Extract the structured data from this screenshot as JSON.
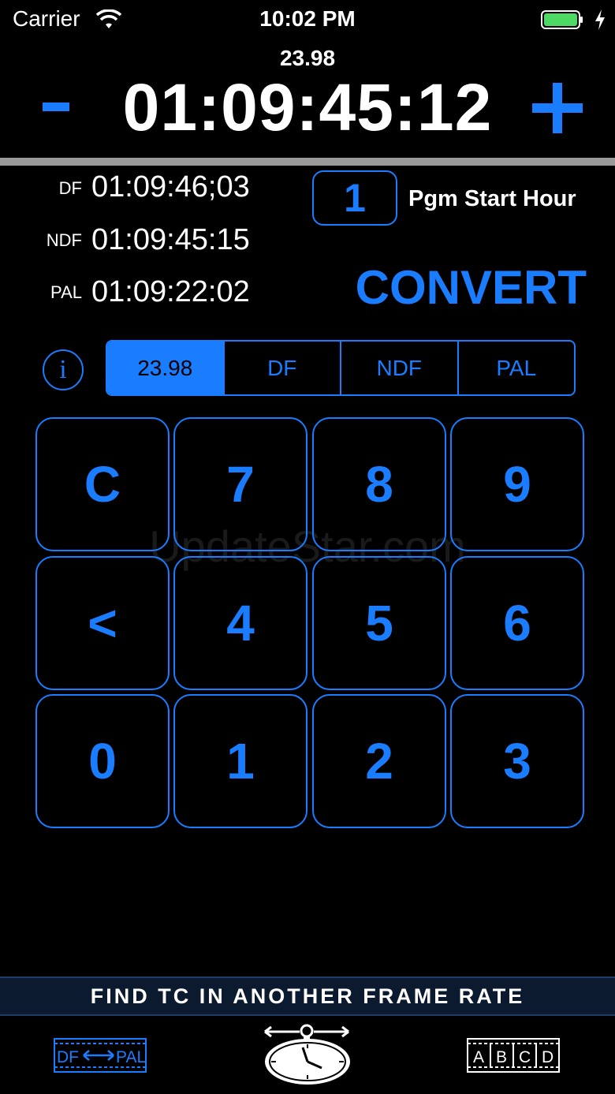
{
  "status_bar": {
    "carrier": "Carrier",
    "time": "10:02 PM"
  },
  "header": {
    "frame_rate": "23.98",
    "timecode": "01:09:45:12",
    "minus_label": "-",
    "plus_label": "+"
  },
  "conversions": [
    {
      "label": "DF",
      "value": "01:09:46;03"
    },
    {
      "label": "NDF",
      "value": "01:09:45:15"
    },
    {
      "label": "PAL",
      "value": "01:09:22:02"
    }
  ],
  "pgm_start": {
    "hour": "1",
    "label": "Pgm Start Hour"
  },
  "convert_label": "CONVERT",
  "info_label": "i",
  "segments": [
    {
      "label": "23.98",
      "selected": true
    },
    {
      "label": "DF",
      "selected": false
    },
    {
      "label": "NDF",
      "selected": false
    },
    {
      "label": "PAL",
      "selected": false
    }
  ],
  "keypad": {
    "row1": [
      "C",
      "7",
      "8",
      "9"
    ],
    "row2": [
      "<",
      "4",
      "5",
      "6"
    ],
    "row3": [
      "0",
      "1",
      "2",
      "3"
    ]
  },
  "watermark": "UpdateStar.com",
  "banner": "FIND TC IN ANOTHER FRAME RATE",
  "tabs": {
    "left": {
      "text_a": "DF",
      "text_b": "PAL",
      "icon": "frame-rate-convert-icon"
    },
    "center": {
      "icon": "stopwatch-icon"
    },
    "right": {
      "letters": [
        "A",
        "B",
        "C",
        "D"
      ],
      "icon": "filmstrip-icon"
    }
  },
  "colors": {
    "accent": "#1a7dff",
    "background": "#000000",
    "divider": "#9a9a9a",
    "battery": "#4cd964"
  }
}
